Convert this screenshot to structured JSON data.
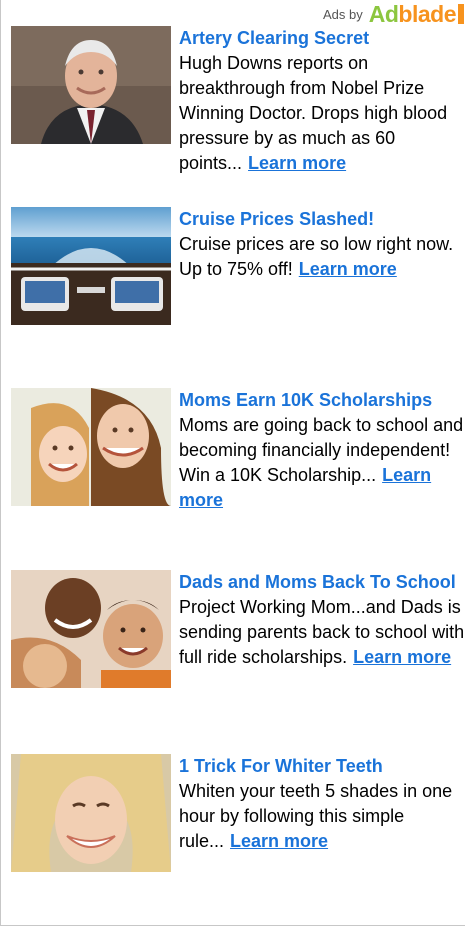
{
  "header": {
    "ads_by": "Ads by",
    "logo": {
      "a": "A",
      "d": "d",
      "rest": "blade"
    }
  },
  "ads": [
    {
      "title": "Artery Clearing Secret",
      "body": "Hugh Downs reports on breakthrough from Nobel Prize Winning Doctor. Drops high blood pressure by as much as 60 points...",
      "cta": "Learn more"
    },
    {
      "title": "Cruise Prices Slashed!",
      "body": "Cruise prices are so low right now. Up to 75% off!",
      "cta": "Learn more"
    },
    {
      "title": "Moms Earn 10K Scholarships",
      "body": "Moms are going back to school and becoming financially independent! Win a 10K Scholarship...",
      "cta": "Learn more"
    },
    {
      "title": "Dads and Moms Back To School",
      "body": "Project Working Mom...and Dads is sending parents back to school with full ride scholarships.",
      "cta": "Learn more"
    },
    {
      "title": "1 Trick For Whiter Teeth",
      "body": "Whiten your teeth 5 shades in one hour by following this simple rule...",
      "cta": "Learn more"
    }
  ]
}
